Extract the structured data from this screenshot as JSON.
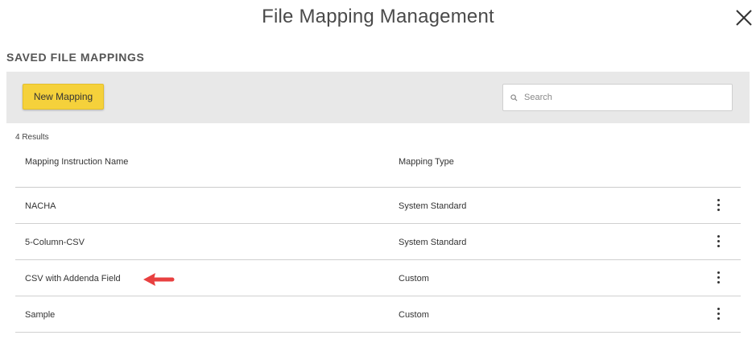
{
  "dialog": {
    "title": "File Mapping Management",
    "close_icon": "close-icon"
  },
  "section": {
    "heading": "SAVED FILE MAPPINGS"
  },
  "toolbar": {
    "new_button_label": "New Mapping",
    "search": {
      "placeholder": "Search",
      "value": "",
      "icon": "search-icon"
    }
  },
  "results": {
    "count_label": "4 Results"
  },
  "table": {
    "headers": [
      "Mapping Instruction Name",
      "Mapping Type"
    ],
    "rows": [
      {
        "name": "NACHA",
        "type": "System Standard"
      },
      {
        "name": "5-Column-CSV",
        "type": "System Standard"
      },
      {
        "name": "CSV with Addenda Field",
        "type": "Custom"
      },
      {
        "name": "Sample",
        "type": "Custom"
      }
    ],
    "row_action_icon": "more-vertical-icon"
  },
  "annotation": {
    "icon": "arrow-left-icon",
    "color": "#e84040"
  },
  "colors": {
    "button": "#f5d13b",
    "toolbar_bg": "#e8e8e8"
  }
}
